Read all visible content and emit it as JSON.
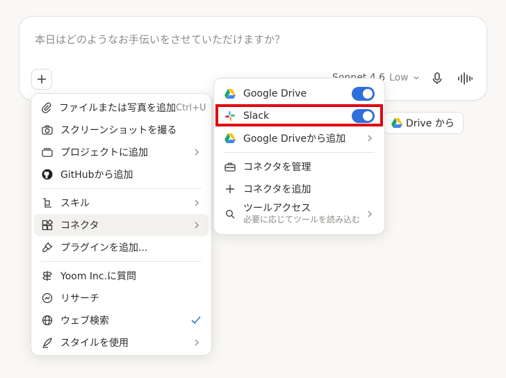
{
  "composer": {
    "placeholder": "本日はどのようなお手伝いをさせていただけますか？",
    "model": "Sonnet 4.6",
    "effort": "Low"
  },
  "chip": {
    "label": "Drive から"
  },
  "menu": {
    "items": [
      {
        "label": "ファイルまたは写真を追加",
        "shortcut": "Ctrl+U"
      },
      {
        "label": "スクリーンショットを撮る"
      },
      {
        "label": "プロジェクトに追加"
      },
      {
        "label": "GitHubから追加"
      },
      {
        "label": "スキル"
      },
      {
        "label": "コネクタ"
      },
      {
        "label": "プラグインを追加..."
      },
      {
        "label": "Yoom Inc.に質問"
      },
      {
        "label": "リサーチ"
      },
      {
        "label": "ウェブ検索"
      },
      {
        "label": "スタイルを使用"
      }
    ]
  },
  "submenu": {
    "items": [
      {
        "label": "Google Drive",
        "enabled": true
      },
      {
        "label": "Slack",
        "enabled": true
      },
      {
        "label": "Google Driveから追加"
      },
      {
        "label": "コネクタを管理"
      },
      {
        "label": "コネクタを追加"
      },
      {
        "label": "ツールアクセス",
        "sublabel": "必要に応じてツールを読み込む"
      }
    ]
  },
  "colors": {
    "toggle_on": "#2f6fdc",
    "highlight": "#e10010",
    "check": "#2f6fdc"
  }
}
